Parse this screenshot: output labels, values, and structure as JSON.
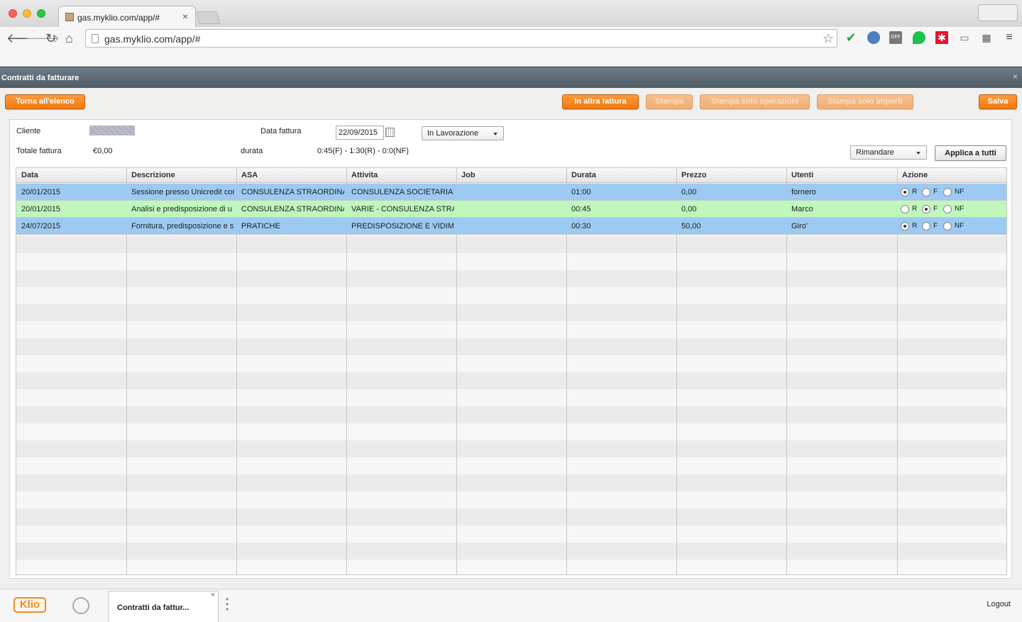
{
  "browser": {
    "tab_title": "gas.myklio.com/app/#",
    "tab_close": "×",
    "url": "gas.myklio.com/app/#",
    "ext_off": "OFF"
  },
  "panel": {
    "title": "Contratti da fatturare",
    "close": "×"
  },
  "actions": {
    "back": "Torna all'elenco",
    "other_invoice": "In altra fattura",
    "print": "Stampa",
    "print_ops": "Stampa solo operazioni",
    "print_amounts": "Stampa solo importi",
    "save": "Salva"
  },
  "form": {
    "cliente_label": "Cliente",
    "data_fattura_label": "Data fattura",
    "data_fattura_value": "22/09/2015",
    "status_value": "In Lavorazione",
    "totale_label": "Totale fattura",
    "totale_value": "€0,00",
    "durata_label": "durata",
    "durata_value": "0:45(F) - 1:30(R) - 0:0(NF)",
    "bulk_action_value": "Rimandare",
    "apply_all": "Applica a tutti"
  },
  "grid": {
    "columns": [
      "Data",
      "Descrizione",
      "ASA",
      "Attivita",
      "Job",
      "Durata",
      "Prezzo",
      "Utenti",
      "Azione"
    ],
    "radio_labels": [
      "R",
      "F",
      "NF"
    ],
    "rows": [
      {
        "data": "20/01/2015",
        "descrizione": "Sessione presso Unicredit con",
        "asa": "CONSULENZA STRAORDINARIA",
        "attivita": "CONSULENZA SOCIETARIA S",
        "job": "",
        "durata": "01:00",
        "prezzo": "0,00",
        "utenti": "fornero",
        "azione": "R",
        "color": "#9ccaf2"
      },
      {
        "data": "20/01/2015",
        "descrizione": "Analisi e predisposizione di u",
        "asa": "CONSULENZA STRAORDINARIA",
        "attivita": "VARIE - CONSULENZA STRAO",
        "job": "",
        "durata": "00:45",
        "prezzo": "0,00",
        "utenti": "Marco",
        "azione": "F",
        "color": "#bff7bd"
      },
      {
        "data": "24/07/2015",
        "descrizione": "Fornitura, predisposizione e s",
        "asa": "PRATICHE",
        "attivita": "PREDISPOSIZIONE E VIDIMA",
        "job": "",
        "durata": "00:30",
        "prezzo": "50,00",
        "utenti": "Giro'",
        "azione": "R",
        "color": "#9ccaf2"
      }
    ]
  },
  "taskbar": {
    "logo": "Klio",
    "tab_title": "Contratti da fattur...",
    "tab_close": "×",
    "logout": "Logout"
  }
}
